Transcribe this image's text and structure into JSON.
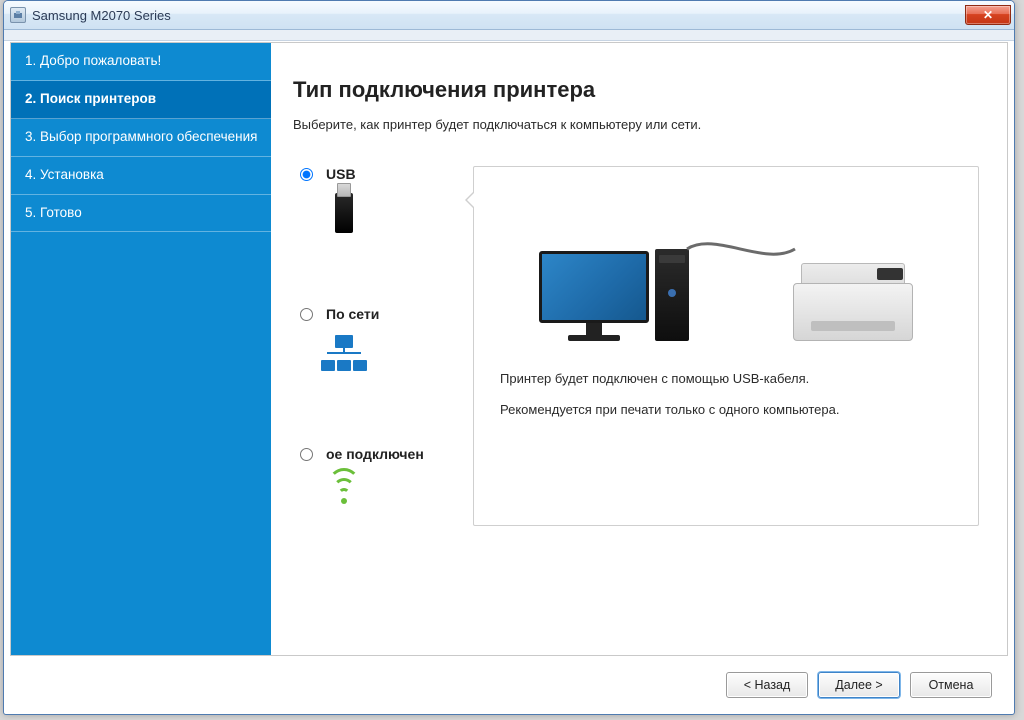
{
  "window": {
    "title": "Samsung M2070 Series"
  },
  "sidebar": {
    "steps": [
      {
        "label": "1. Добро пожаловать!"
      },
      {
        "label": "2. Поиск принтеров"
      },
      {
        "label": "3. Выбор программного обеспечения"
      },
      {
        "label": "4. Установка"
      },
      {
        "label": "5. Готово"
      }
    ],
    "active_index": 1
  },
  "main": {
    "heading": "Тип подключения принтера",
    "subtitle": "Выберите, как принтер будет подключаться к компьютеру или сети.",
    "options": {
      "usb": {
        "label": "USB",
        "selected": true
      },
      "network": {
        "label": "По сети",
        "selected": false
      },
      "wireless": {
        "label": "ое подключен",
        "selected": false
      }
    },
    "preview": {
      "line1": "Принтер будет подключен с помощью USB-кабеля.",
      "line2": "Рекомендуется при печати только с одного компьютера."
    }
  },
  "footer": {
    "back": "< Назад",
    "next": "Далее >",
    "cancel": "Отмена"
  }
}
